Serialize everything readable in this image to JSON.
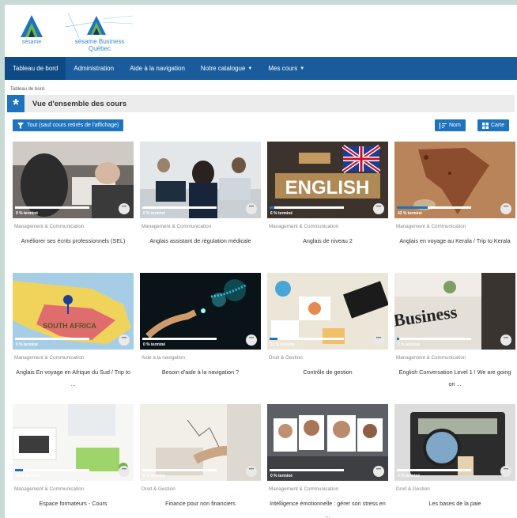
{
  "logos": {
    "primary": "sésame",
    "secondary": "sésame Business Québec"
  },
  "nav": [
    {
      "label": "Tableau de bord",
      "active": true,
      "dropdown": false
    },
    {
      "label": "Administration",
      "active": false,
      "dropdown": false
    },
    {
      "label": "Aide à la navigation",
      "active": false,
      "dropdown": false
    },
    {
      "label": "Notre catalogue",
      "active": false,
      "dropdown": true
    },
    {
      "label": "Mes cours",
      "active": false,
      "dropdown": true
    }
  ],
  "breadcrumb": "Tableau de bord",
  "page_title": "Vue d'ensemble des cours",
  "toolbar": {
    "filter_label": "Tout (sauf cours retirés de l'affichage)",
    "sort_label": "Nom",
    "view_label": "Carte"
  },
  "colors": {
    "primary": "#1e73be",
    "navbar": "#1a5c9b",
    "navbar_active": "#0d4a86"
  },
  "courses": [
    {
      "category": "Management & Communication",
      "title": "Améliorer ses écrits professionnels (SEL)",
      "progress_label": "0 % terminé",
      "progress": 0,
      "image": "people-at-laptop"
    },
    {
      "category": "Management & Communication",
      "title": "Anglais assistant de régulation médicale",
      "progress_label": "0 % terminé",
      "progress": 0,
      "image": "call-center"
    },
    {
      "category": "Management & Communication",
      "title": "Anglais de niveau 2",
      "progress_label": "6 % terminé",
      "progress": 6,
      "image": "english-blocks"
    },
    {
      "category": "Management & Communication",
      "title": "Anglais en voyage au Kerala / Trip to Kerala",
      "progress_label": "42 % terminé",
      "progress": 42,
      "image": "india-map"
    },
    {
      "category": "Management & Communication",
      "title": "Anglais En voyage en Afrique du Sud / Trip to ...",
      "progress_label": "0 % terminé",
      "progress": 0,
      "image": "south-africa-map"
    },
    {
      "category": "Aide à la navigation",
      "title": "Besoin d'aide à la navigation ?",
      "progress_label": "0 % terminé",
      "progress": 0,
      "image": "digital-hand"
    },
    {
      "category": "Droit & Gestion",
      "title": "Contrôle de gestion",
      "progress_label": "11 % terminé",
      "progress": 11,
      "image": "desk-charts"
    },
    {
      "category": "Management & Communication",
      "title": "English Conversation Level 1 ! We are going on ...",
      "progress_label": "3 % terminé",
      "progress": 3,
      "image": "business-newspaper"
    },
    {
      "category": "Management & Communication",
      "title": "Espace formateurs - Cours",
      "progress_label": "11 % terminé",
      "progress": 11,
      "image": "office-desk"
    },
    {
      "category": "Droit & Gestion",
      "title": "Finance pour non financiers",
      "progress_label": "0 % terminé",
      "progress": 0,
      "image": "hand-chart"
    },
    {
      "category": "Management & Communication",
      "title": "Intelligence émotionnelle : gérer son stress en ...",
      "progress_label": "0 % terminé",
      "progress": 0,
      "image": "emotion-faces"
    },
    {
      "category": "Droit & Gestion",
      "title": "Les bases de la paie",
      "progress_label": "0 % terminé",
      "progress": 0,
      "image": "calculator-money"
    }
  ]
}
